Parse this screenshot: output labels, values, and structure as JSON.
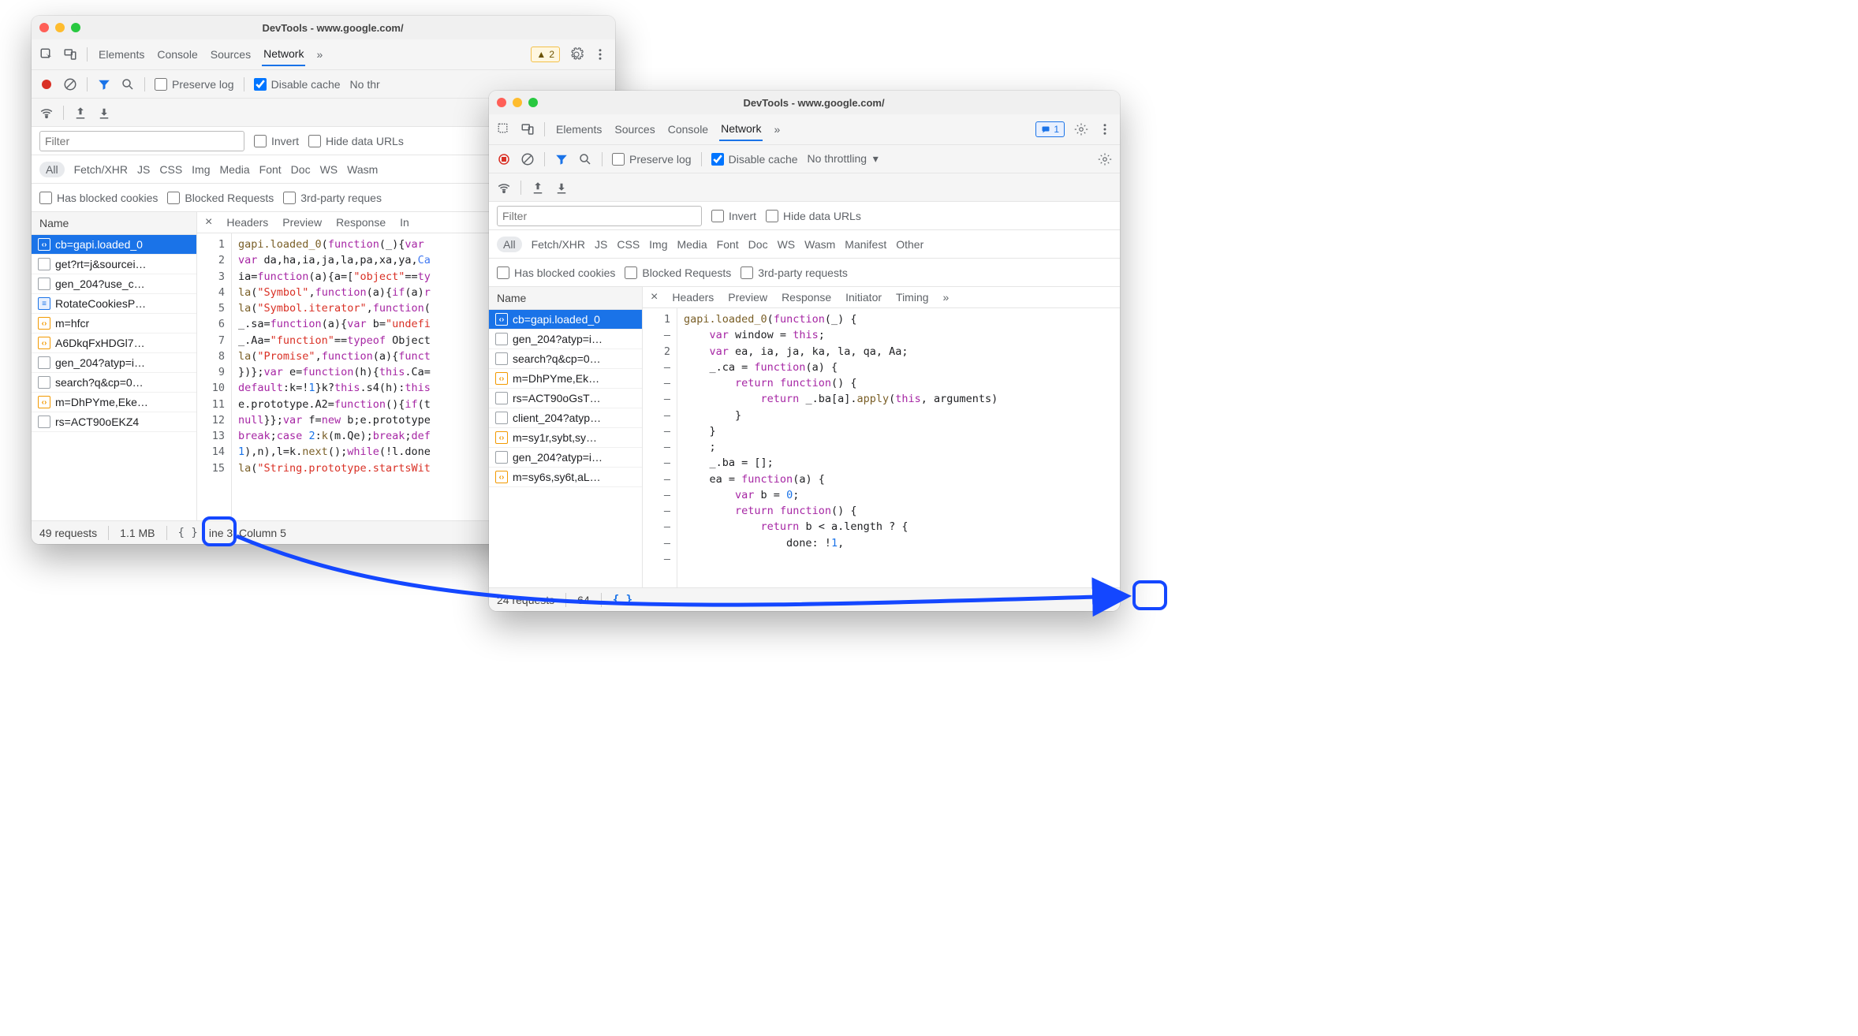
{
  "windows": {
    "left": {
      "title": "DevTools - www.google.com/",
      "tabs": [
        "Elements",
        "Console",
        "Sources",
        "Network"
      ],
      "active_tab": "Network",
      "more_glyph": "»",
      "warning_count": "2",
      "toolbar": {
        "preserve_log": "Preserve log",
        "disable_cache": "Disable cache",
        "no_throttling": "No thr"
      },
      "filter_placeholder": "Filter",
      "filter_options": {
        "invert": "Invert",
        "hide_data": "Hide data URLs"
      },
      "types": [
        "All",
        "Fetch/XHR",
        "JS",
        "CSS",
        "Img",
        "Media",
        "Font",
        "Doc",
        "WS",
        "Wasm"
      ],
      "extra_filters": [
        "Has blocked cookies",
        "Blocked Requests",
        "3rd-party reques"
      ],
      "name_header": "Name",
      "requests": [
        {
          "icon": "orange",
          "glyph": "‹›",
          "label": "cb=gapi.loaded_0",
          "selected": true
        },
        {
          "icon": "gray",
          "glyph": "",
          "label": "get?rt=j&sourcei…"
        },
        {
          "icon": "gray",
          "glyph": "",
          "label": "gen_204?use_c…"
        },
        {
          "icon": "blue",
          "glyph": "≡",
          "label": "RotateCookiesP…"
        },
        {
          "icon": "orange",
          "glyph": "‹›",
          "label": "m=hfcr"
        },
        {
          "icon": "orange",
          "glyph": "‹›",
          "label": "A6DkqFxHDGl7…"
        },
        {
          "icon": "gray",
          "glyph": "",
          "label": "gen_204?atyp=i…"
        },
        {
          "icon": "gray",
          "glyph": "",
          "label": "search?q&cp=0…"
        },
        {
          "icon": "orange",
          "glyph": "‹›",
          "label": "m=DhPYme,Eke…"
        },
        {
          "icon": "gray",
          "glyph": "",
          "label": "rs=ACT90oEKZ4"
        }
      ],
      "sub_tabs": [
        "Headers",
        "Preview",
        "Response",
        "In"
      ],
      "sub_active": "Response",
      "code_gutter": [
        "1",
        "2",
        "3",
        "4",
        "5",
        "6",
        "7",
        "8",
        "9",
        "10",
        "11",
        "12",
        "13",
        "14",
        "15"
      ],
      "code_lines": [
        [
          [
            "call",
            "gapi.loaded_0"
          ],
          [
            "",
            "("
          ],
          [
            "kw",
            "function"
          ],
          [
            "",
            "(_){"
          ],
          [
            "kw",
            "var"
          ]
        ],
        [
          [
            "kw",
            "var"
          ],
          [
            "",
            " da,ha,ia,ja,la,pa,xa,ya,"
          ],
          [
            "def",
            "Ca"
          ]
        ],
        [
          [
            "",
            "ia="
          ],
          [
            "kw",
            "function"
          ],
          [
            "",
            "(a){a=["
          ],
          [
            "str",
            "\"object\""
          ],
          [
            "",
            "=="
          ],
          [
            "kw",
            "ty"
          ]
        ],
        [
          [
            "call",
            "la"
          ],
          [
            "",
            "("
          ],
          [
            "str",
            "\"Symbol\""
          ],
          [
            "",
            ","
          ],
          [
            "kw",
            "function"
          ],
          [
            "",
            "(a){"
          ],
          [
            "kw",
            "if"
          ],
          [
            "",
            "(a)"
          ],
          [
            "kw",
            "r"
          ]
        ],
        [
          [
            "call",
            "la"
          ],
          [
            "",
            "("
          ],
          [
            "str",
            "\"Symbol.iterator\""
          ],
          [
            "",
            ","
          ],
          [
            "kw",
            "function"
          ],
          [
            "",
            "("
          ]
        ],
        [
          [
            "",
            "_.sa="
          ],
          [
            "kw",
            "function"
          ],
          [
            "",
            "(a){"
          ],
          [
            "kw",
            "var"
          ],
          [
            "",
            " b="
          ],
          [
            "str",
            "\"undefi"
          ]
        ],
        [
          [
            "",
            "_.Aa="
          ],
          [
            "str",
            "\"function\""
          ],
          [
            "",
            "=="
          ],
          [
            "kw",
            "typeof"
          ],
          [
            "",
            " Object"
          ]
        ],
        [
          [
            "call",
            "la"
          ],
          [
            "",
            "("
          ],
          [
            "str",
            "\"Promise\""
          ],
          [
            "",
            ","
          ],
          [
            "kw",
            "function"
          ],
          [
            "",
            "(a){"
          ],
          [
            "kw",
            "funct"
          ]
        ],
        [
          [
            "",
            "})};"
          ],
          [
            "kw",
            "var"
          ],
          [
            "",
            " e="
          ],
          [
            "kw",
            "function"
          ],
          [
            "",
            "(h){"
          ],
          [
            "kw",
            "this"
          ],
          [
            "",
            ".Ca="
          ]
        ],
        [
          [
            "kw",
            "default"
          ],
          [
            "",
            ":k=!"
          ],
          [
            "num",
            "1"
          ],
          [
            "",
            "}k?"
          ],
          [
            "kw",
            "this"
          ],
          [
            "",
            ".s4(h):"
          ],
          [
            "kw",
            "this"
          ]
        ],
        [
          [
            "",
            "e.prototype.A2="
          ],
          [
            "kw",
            "function"
          ],
          [
            "",
            "(){"
          ],
          [
            "kw",
            "if"
          ],
          [
            "",
            "(t"
          ]
        ],
        [
          [
            "kw",
            "null"
          ],
          [
            "",
            "}};"
          ],
          [
            "kw",
            "var"
          ],
          [
            "",
            " f="
          ],
          [
            "kw",
            "new"
          ],
          [
            "",
            " b;e.prototype"
          ]
        ],
        [
          [
            "kw",
            "break"
          ],
          [
            "",
            ";"
          ],
          [
            "kw",
            "case"
          ],
          [
            "",
            " "
          ],
          [
            "num",
            "2"
          ],
          [
            "",
            ":"
          ],
          [
            "call",
            "k"
          ],
          [
            "",
            "(m.Qe);"
          ],
          [
            "kw",
            "break"
          ],
          [
            "",
            ";"
          ],
          [
            "kw",
            "def"
          ]
        ],
        [
          [
            "num",
            "1"
          ],
          [
            "",
            "),n),l=k."
          ],
          [
            "call",
            "next"
          ],
          [
            "",
            "();"
          ],
          [
            "kw",
            "while"
          ],
          [
            "",
            "(!l.done"
          ]
        ],
        [
          [
            "call",
            "la"
          ],
          [
            "",
            "("
          ],
          [
            "str",
            "\"String.prototype.startsWit"
          ]
        ]
      ],
      "status": {
        "requests": "49 requests",
        "size": "1.1 MB",
        "braces": "{ }",
        "cursor": "ine 3, Column 5"
      }
    },
    "right": {
      "title": "DevTools - www.google.com/",
      "tabs": [
        "Elements",
        "Sources",
        "Console",
        "Network"
      ],
      "active_tab": "Network",
      "more_glyph": "»",
      "msg_count": "1",
      "toolbar": {
        "preserve_log": "Preserve log",
        "disable_cache": "Disable cache",
        "no_throttling": "No throttling"
      },
      "filter_placeholder": "Filter",
      "filter_options": {
        "invert": "Invert",
        "hide_data": "Hide data URLs"
      },
      "types": [
        "All",
        "Fetch/XHR",
        "JS",
        "CSS",
        "Img",
        "Media",
        "Font",
        "Doc",
        "WS",
        "Wasm",
        "Manifest",
        "Other"
      ],
      "extra_filters": [
        "Has blocked cookies",
        "Blocked Requests",
        "3rd-party requests"
      ],
      "name_header": "Name",
      "requests": [
        {
          "icon": "orange",
          "glyph": "‹›",
          "label": "cb=gapi.loaded_0",
          "selected": true
        },
        {
          "icon": "gray",
          "glyph": "",
          "label": "gen_204?atyp=i…"
        },
        {
          "icon": "gray",
          "glyph": "",
          "label": "search?q&cp=0…"
        },
        {
          "icon": "orange",
          "glyph": "‹›",
          "label": "m=DhPYme,Ek…"
        },
        {
          "icon": "gray",
          "glyph": "",
          "label": "rs=ACT90oGsT…"
        },
        {
          "icon": "gray",
          "glyph": "",
          "label": "client_204?atyp…"
        },
        {
          "icon": "orange",
          "glyph": "‹›",
          "label": "m=sy1r,sybt,sy…"
        },
        {
          "icon": "gray",
          "glyph": "",
          "label": "gen_204?atyp=i…"
        },
        {
          "icon": "orange",
          "glyph": "‹›",
          "label": "m=sy6s,sy6t,aL…"
        }
      ],
      "sub_tabs": [
        "Headers",
        "Preview",
        "Response",
        "Initiator",
        "Timing"
      ],
      "sub_more": "»",
      "sub_active": "Response",
      "code_gutter": [
        "1",
        "–",
        "2",
        "–",
        "–",
        "–",
        "–",
        "–",
        "–",
        "–",
        "–",
        "–",
        "–",
        "–",
        "–",
        "–"
      ],
      "code_lines": [
        [
          [
            "call",
            "gapi.loaded_0"
          ],
          [
            "",
            "("
          ],
          [
            "kw",
            "function"
          ],
          [
            "",
            "(_) {"
          ]
        ],
        [
          [
            "",
            "    "
          ],
          [
            "kw",
            "var"
          ],
          [
            "",
            " window = "
          ],
          [
            "kw",
            "this"
          ],
          [
            "",
            ";"
          ]
        ],
        [
          [
            "",
            "    "
          ],
          [
            "kw",
            "var"
          ],
          [
            "",
            " ea, ia, ja, ka, la, qa, Aa;"
          ]
        ],
        [
          [
            "",
            "    _.ca = "
          ],
          [
            "kw",
            "function"
          ],
          [
            "",
            "(a) {"
          ]
        ],
        [
          [
            "",
            "        "
          ],
          [
            "kw",
            "return"
          ],
          [
            "",
            " "
          ],
          [
            "kw",
            "function"
          ],
          [
            "",
            "() {"
          ]
        ],
        [
          [
            "",
            "            "
          ],
          [
            "kw",
            "return"
          ],
          [
            "",
            " _.ba[a]."
          ],
          [
            "call",
            "apply"
          ],
          [
            "",
            "("
          ],
          [
            "kw",
            "this"
          ],
          [
            "",
            ", arguments)"
          ]
        ],
        [
          [
            "",
            "        }"
          ]
        ],
        [
          [
            "",
            "    }"
          ]
        ],
        [
          [
            "",
            "    ;"
          ]
        ],
        [
          [
            "",
            "    _.ba = [];"
          ]
        ],
        [
          [
            "",
            "    ea = "
          ],
          [
            "kw",
            "function"
          ],
          [
            "",
            "(a) {"
          ]
        ],
        [
          [
            "",
            "        "
          ],
          [
            "kw",
            "var"
          ],
          [
            "",
            " b = "
          ],
          [
            "num",
            "0"
          ],
          [
            "",
            ";"
          ]
        ],
        [
          [
            "",
            "        "
          ],
          [
            "kw",
            "return"
          ],
          [
            "",
            " "
          ],
          [
            "kw",
            "function"
          ],
          [
            "",
            "() {"
          ]
        ],
        [
          [
            "",
            "            "
          ],
          [
            "kw",
            "return"
          ],
          [
            "",
            " b < a.length ? {"
          ]
        ],
        [
          [
            "",
            "                done: !"
          ],
          [
            "num",
            "1"
          ],
          [
            "",
            ","
          ]
        ]
      ],
      "status": {
        "requests": "24 requests",
        "size": "64",
        "braces": "{ }"
      }
    }
  }
}
